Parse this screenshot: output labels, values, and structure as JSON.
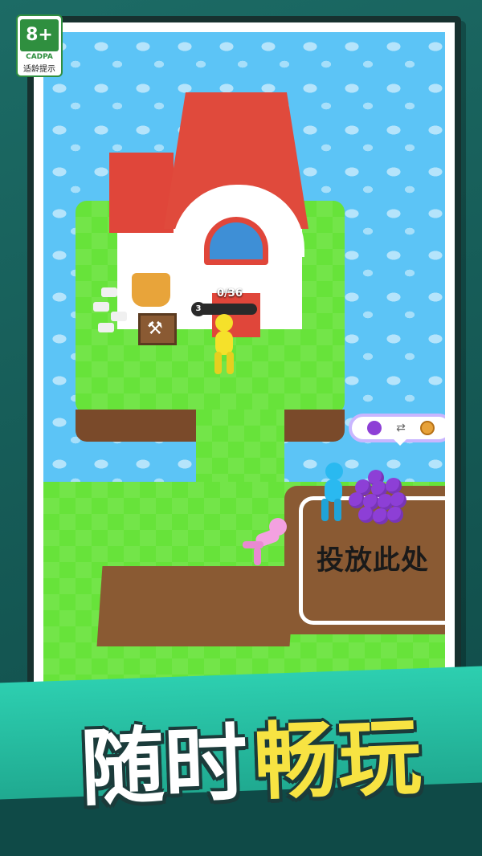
{
  "rating_badge": {
    "age": "8+",
    "org": "CADPA",
    "caption": "适龄提示",
    "color": "#2f8f3f"
  },
  "game_scene": {
    "build_progress": {
      "count_text": "0/36",
      "level": "3",
      "fill": 0.0
    },
    "trade_bubble": {
      "from_icon": "grape-icon",
      "arrow_icon": "swap-icon",
      "to_icon": "coin-icon"
    },
    "drop_zone_label": "投放此处",
    "sign_icon": "digging-worker-icon",
    "colors": {
      "grass": "#67e33a",
      "water": "#5cc4f6",
      "dirt": "#8a5a33",
      "roof": "#e04a3c",
      "player": "#f5e12a",
      "npc_pink": "#f3a1e0",
      "npc_blue": "#2ab9f0",
      "grape": "#8d3fd6"
    }
  },
  "headline": {
    "part1": "随时",
    "part2": "畅玩",
    "color_part1": "#ffffff",
    "color_part2": "#f7e342"
  }
}
